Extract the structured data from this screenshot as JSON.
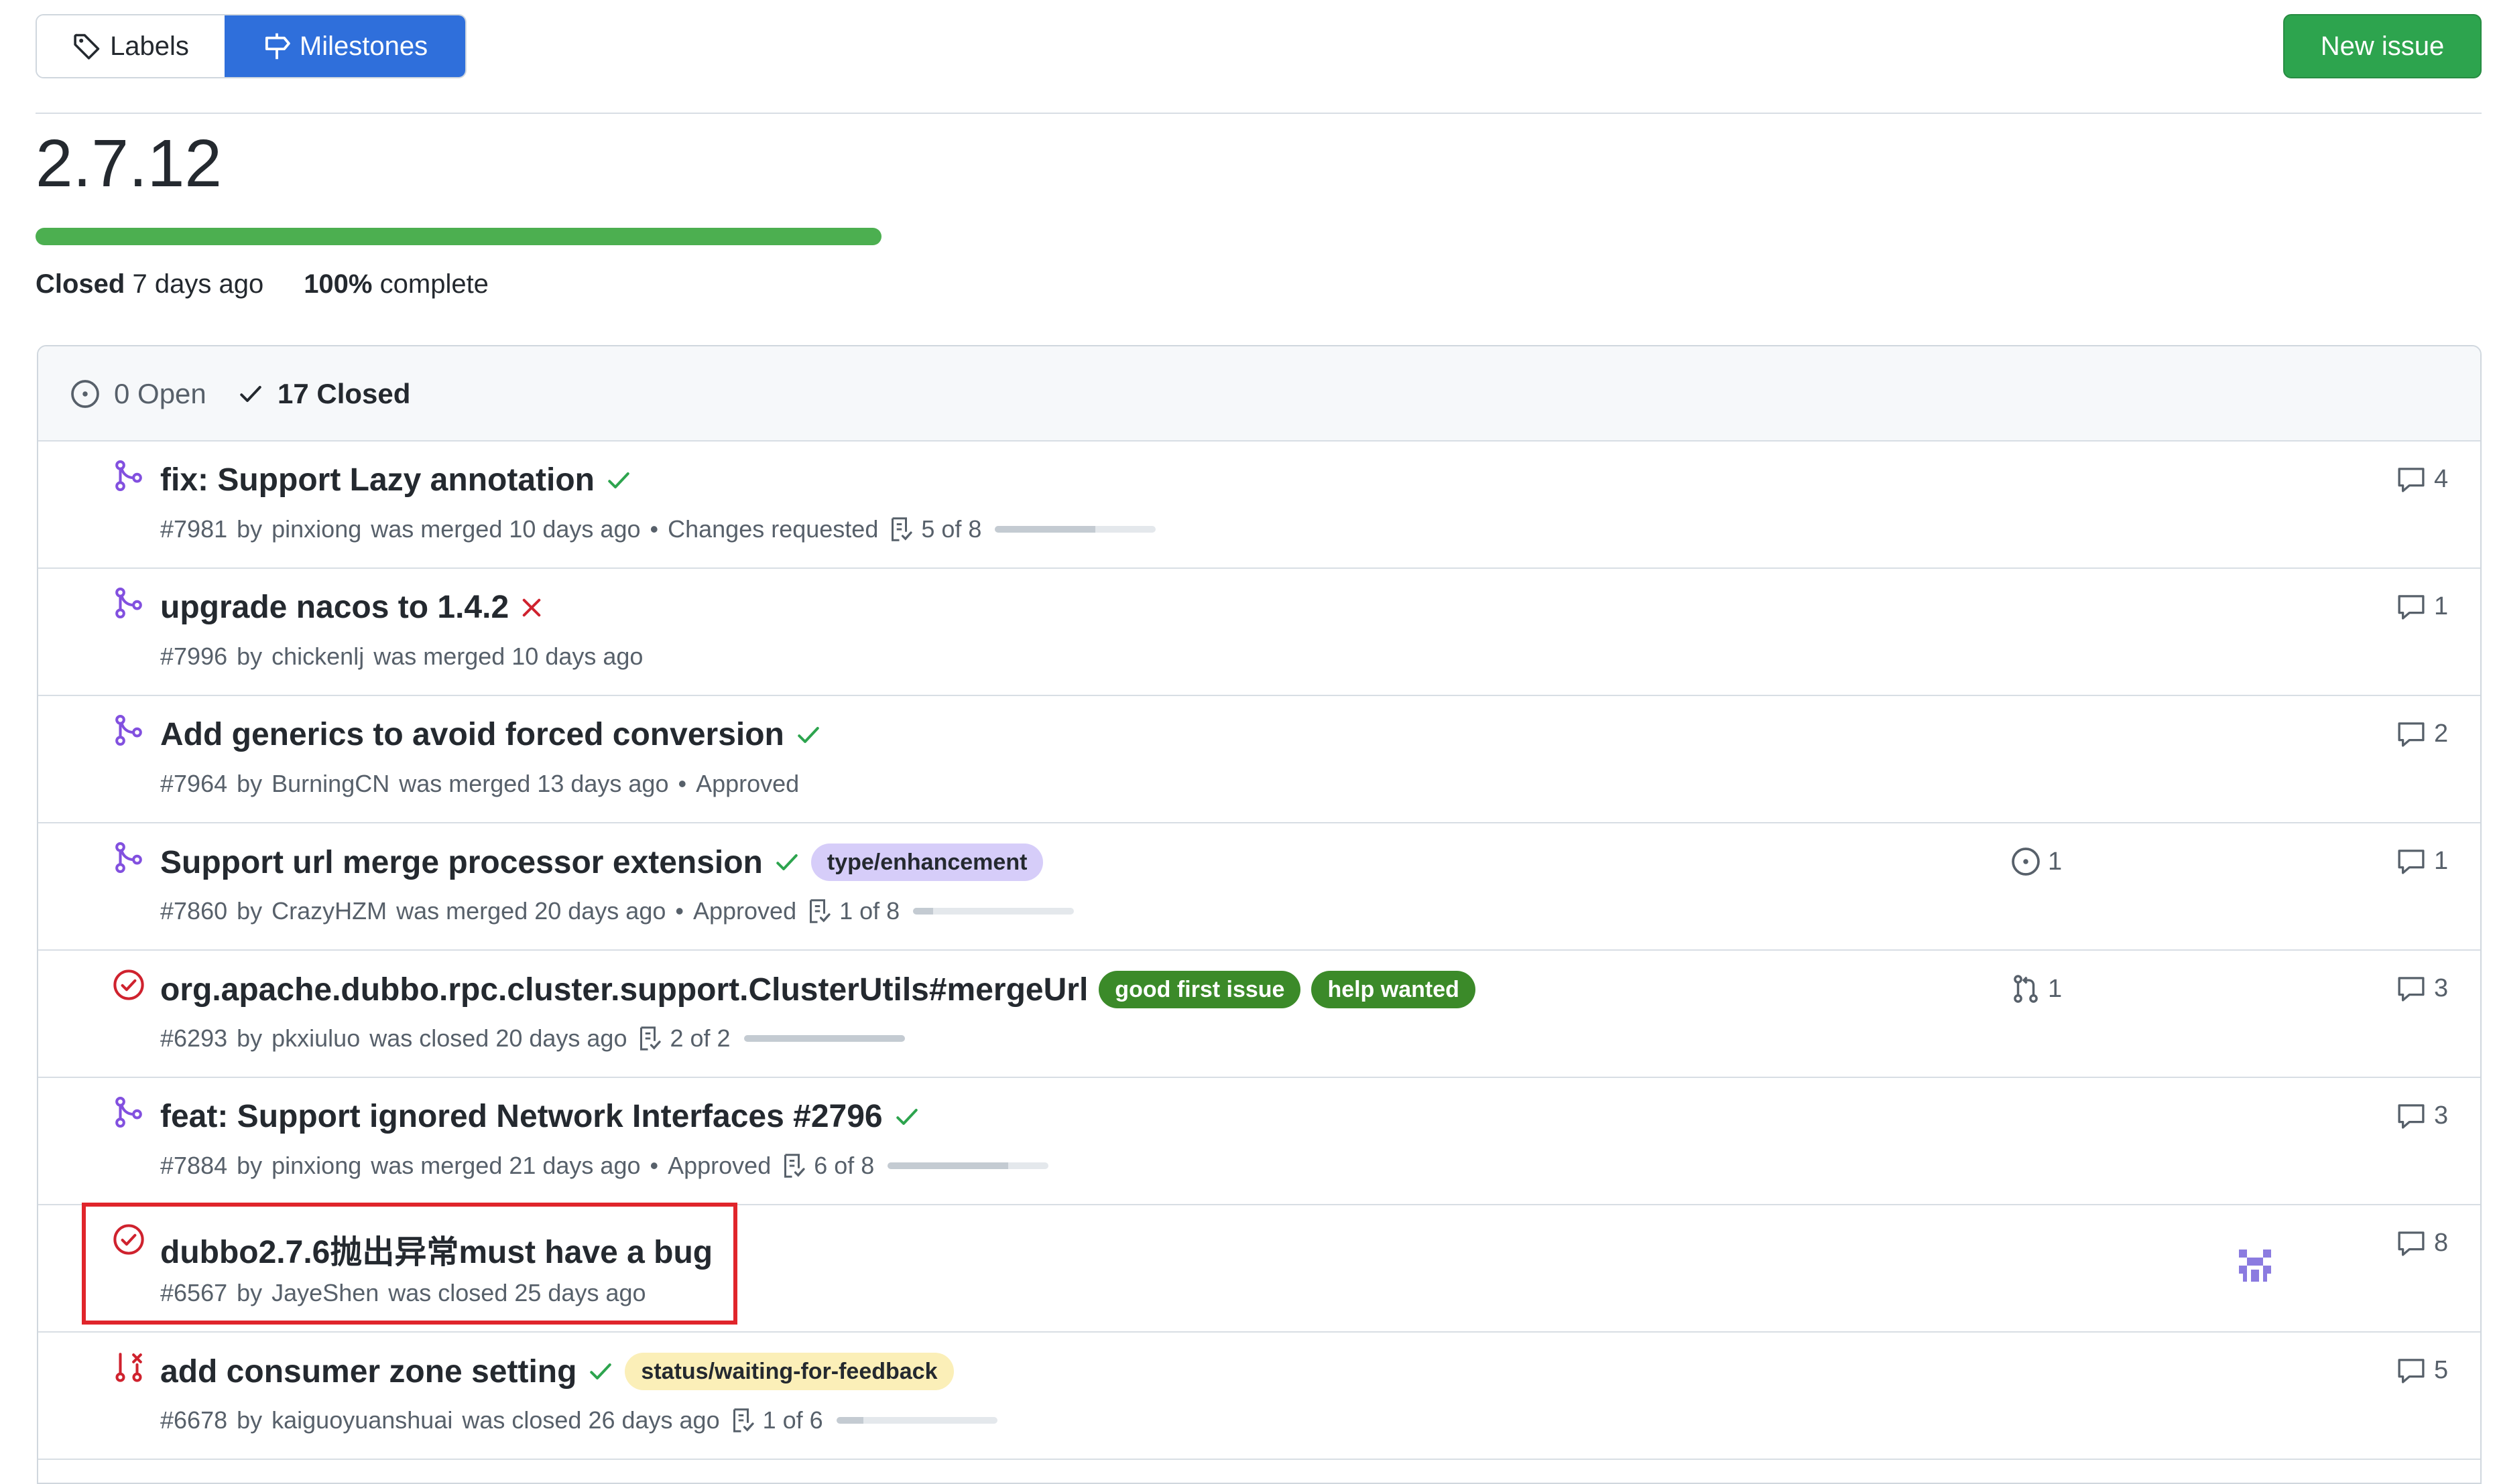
{
  "nav": {
    "labels": "Labels",
    "milestones": "Milestones",
    "new_issue": "New issue"
  },
  "milestone": {
    "title": "2.7.12",
    "progress_percent": 100,
    "closed_label": "Closed",
    "closed_when": "7 days ago",
    "percent_label": "100%",
    "complete_label": "complete"
  },
  "states": {
    "open": "0 Open",
    "closed": "17 Closed"
  },
  "colors": {
    "accent_blue": "#2f6fdb",
    "green": "#2da44e",
    "merged_purple": "#8250df",
    "closed_red": "#cf222e",
    "highlight_red": "#e0252b"
  },
  "items": [
    {
      "title": "fix: Support Lazy annotation",
      "status": "success",
      "icon": "merged-pr-icon",
      "number": "#7981",
      "by": "by",
      "author": "pinxiong",
      "action": "was merged 10 days ago",
      "review": "Changes requested",
      "tasks": "5 of 8",
      "task_fraction": 0.625,
      "comments": "4"
    },
    {
      "title": "upgrade nacos to 1.4.2",
      "status": "failure",
      "icon": "merged-pr-icon",
      "number": "#7996",
      "by": "by",
      "author": "chickenlj",
      "action": "was merged 10 days ago",
      "comments": "1"
    },
    {
      "title": "Add generics to avoid forced conversion",
      "status": "success",
      "icon": "merged-pr-icon",
      "number": "#7964",
      "by": "by",
      "author": "BurningCN",
      "action": "was merged 13 days ago",
      "review": "Approved",
      "comments": "2"
    },
    {
      "title": "Support url merge processor extension",
      "status": "success",
      "icon": "merged-pr-icon",
      "labels": [
        {
          "name": "type/enhancement",
          "bg": "#d6cdf9",
          "fg": "#24292f"
        }
      ],
      "number": "#7860",
      "by": "by",
      "author": "CrazyHZM",
      "action": "was merged 20 days ago",
      "review": "Approved",
      "tasks": "1 of 8",
      "task_fraction": 0.125,
      "linked": "1",
      "linked_icon": "issue-icon",
      "comments": "1"
    },
    {
      "title": "org.apache.dubbo.rpc.cluster.support.ClusterUtils#mergeUrl",
      "icon": "closed-issue-icon",
      "labels": [
        {
          "name": "good first issue",
          "bg": "#3b8a29",
          "fg": "#ffffff"
        },
        {
          "name": "help wanted",
          "bg": "#3b8a29",
          "fg": "#ffffff"
        }
      ],
      "number": "#6293",
      "by": "by",
      "author": "pkxiuluo",
      "action": "was closed 20 days ago",
      "tasks": "2 of 2",
      "task_fraction": 1.0,
      "linked": "1",
      "linked_icon": "pull-request-icon",
      "comments": "3"
    },
    {
      "title": "feat: Support ignored Network Interfaces #2796",
      "status": "success",
      "icon": "merged-pr-icon",
      "number": "#7884",
      "by": "by",
      "author": "pinxiong",
      "action": "was merged 21 days ago",
      "review": "Approved",
      "tasks": "6 of 8",
      "task_fraction": 0.75,
      "comments": "3"
    },
    {
      "title": "dubbo2.7.6抛出异常must have a bug",
      "icon": "closed-issue-icon",
      "number": "#6567",
      "by": "by",
      "author": "JayeShen",
      "action": "was closed 25 days ago",
      "assignee_avatar": "identicon-avatar",
      "comments": "8"
    },
    {
      "title": "add consumer zone setting",
      "status": "success",
      "icon": "closed-pr-icon",
      "labels": [
        {
          "name": "status/waiting-for-feedback",
          "bg": "#fbefb8",
          "fg": "#24292f"
        }
      ],
      "number": "#6678",
      "by": "by",
      "author": "kaiguoyuanshuai",
      "action": "was closed 26 days ago",
      "tasks": "1 of 6",
      "task_fraction": 0.1667,
      "comments": "5"
    }
  ]
}
